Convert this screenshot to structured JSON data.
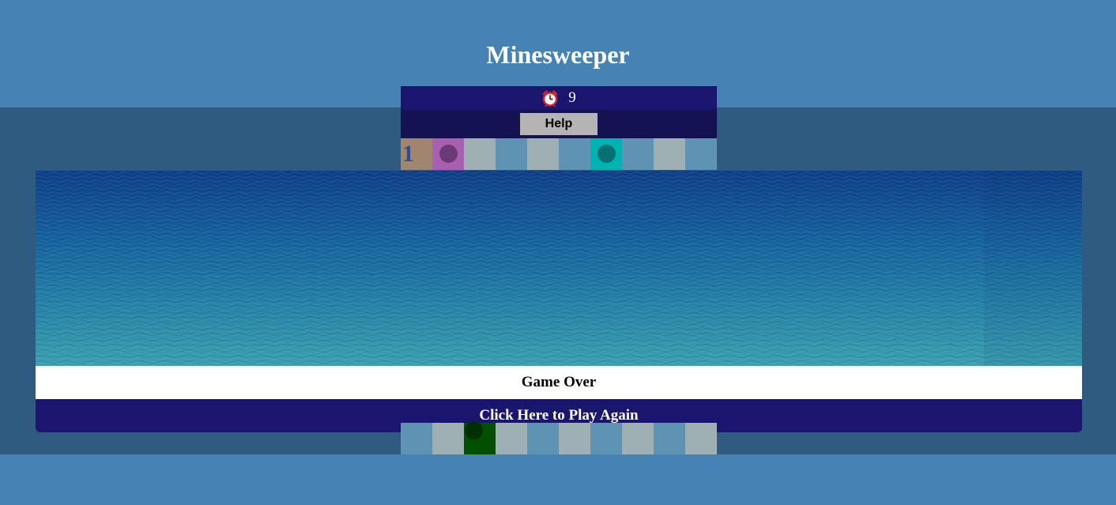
{
  "title": "Minesweeper",
  "timer": {
    "icon": "alarm-clock-icon",
    "value": "9"
  },
  "help_label": "Help",
  "game_over_text": "Game Over",
  "play_again_label": "Click Here to Play Again",
  "colors": {
    "page_bg": "#4682b4",
    "backdrop": "#2f5b80",
    "timer_bar": "#1a1670",
    "help_bar": "#141250",
    "help_button": "#b4b4b4",
    "play_again_bg": "#1a1670",
    "number_text": "#2a4d93"
  },
  "board": {
    "top_row": [
      {
        "state": "revealed-number",
        "text": "1",
        "bg": "#a1866f"
      },
      {
        "state": "mine",
        "bg": "#a95fb0",
        "mine_color": "#6b3a75"
      },
      {
        "state": "hidden",
        "bg": "#9fb0b3"
      },
      {
        "state": "hidden",
        "bg": "#5f93b4"
      },
      {
        "state": "hidden",
        "bg": "#9fb0b3"
      },
      {
        "state": "hidden",
        "bg": "#5f93b4"
      },
      {
        "state": "mine",
        "bg": "#00b3b3",
        "mine_color": "#087070"
      },
      {
        "state": "hidden",
        "bg": "#5f93b4"
      },
      {
        "state": "hidden",
        "bg": "#9fb0b3"
      },
      {
        "state": "hidden",
        "bg": "#5f93b4"
      }
    ],
    "bottom_row": [
      {
        "state": "hidden",
        "bg": "#5f93b4"
      },
      {
        "state": "hidden",
        "bg": "#9fb0b3"
      },
      {
        "state": "mine",
        "bg": "#005000",
        "mine_color": "#003000"
      },
      {
        "state": "hidden",
        "bg": "#9fb0b3"
      },
      {
        "state": "hidden",
        "bg": "#5f93b4"
      },
      {
        "state": "hidden",
        "bg": "#9fb0b3"
      },
      {
        "state": "hidden",
        "bg": "#5f93b4"
      },
      {
        "state": "hidden",
        "bg": "#9fb0b3"
      },
      {
        "state": "hidden",
        "bg": "#5f93b4"
      },
      {
        "state": "hidden",
        "bg": "#9fb0b3"
      }
    ]
  }
}
